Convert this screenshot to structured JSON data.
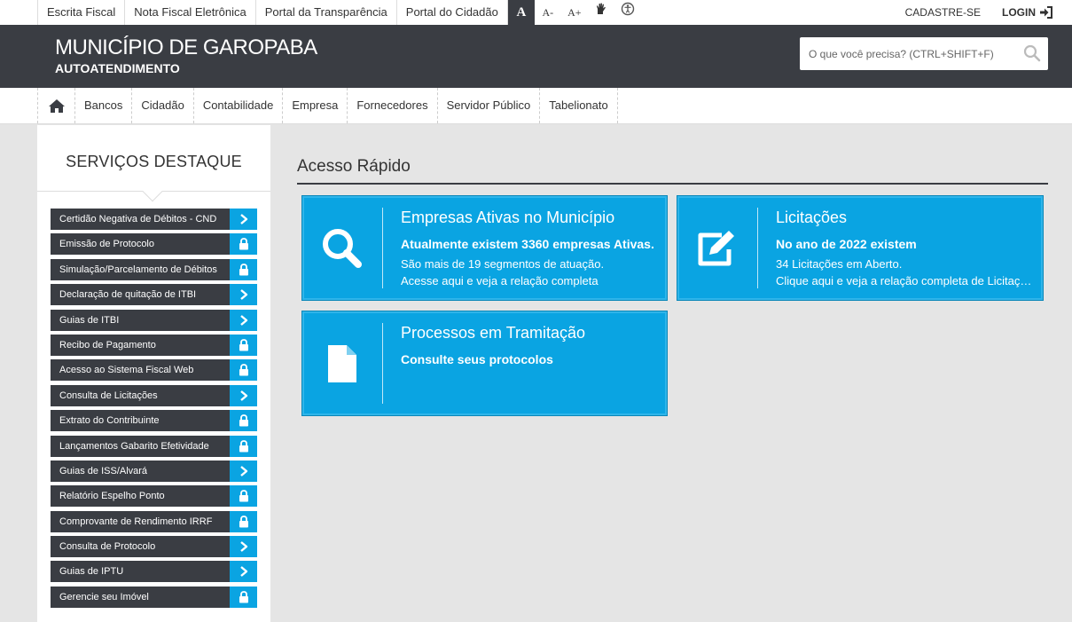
{
  "topbar": {
    "links": [
      "Escrita Fiscal",
      "Nota Fiscal Eletrônica",
      "Portal da Transparência",
      "Portal do Cidadão"
    ],
    "font_normal": "A",
    "font_decrease": "A-",
    "font_increase": "A+",
    "register": "CADASTRE-SE",
    "login": "LOGIN"
  },
  "header": {
    "title": "MUNICÍPIO DE GAROPABA",
    "subtitle": "AUTOATENDIMENTO",
    "search_placeholder": "O que você precisa? (CTRL+SHIFT+F)"
  },
  "nav": {
    "items": [
      "Bancos",
      "Cidadão",
      "Contabilidade",
      "Empresa",
      "Fornecedores",
      "Servidor Público",
      "Tabelionato"
    ]
  },
  "sidebar": {
    "title": "SERVIÇOS DESTAQUE",
    "services": [
      {
        "label": "Certidão Negativa de Débitos - CND",
        "icon": "chevron-right-icon"
      },
      {
        "label": "Emissão de Protocolo",
        "icon": "lock-icon"
      },
      {
        "label": "Simulação/Parcelamento de Débitos",
        "icon": "lock-icon"
      },
      {
        "label": "Declaração de quitação de ITBI",
        "icon": "chevron-right-icon"
      },
      {
        "label": "Guias de ITBI",
        "icon": "chevron-right-icon"
      },
      {
        "label": "Recibo de Pagamento",
        "icon": "lock-icon"
      },
      {
        "label": "Acesso ao Sistema Fiscal Web",
        "icon": "lock-icon"
      },
      {
        "label": "Consulta de Licitações",
        "icon": "chevron-right-icon"
      },
      {
        "label": "Extrato do Contribuinte",
        "icon": "lock-icon"
      },
      {
        "label": "Lançamentos Gabarito Efetividade",
        "icon": "lock-icon"
      },
      {
        "label": "Guias de ISS/Alvará",
        "icon": "chevron-right-icon"
      },
      {
        "label": "Relatório Espelho Ponto",
        "icon": "lock-icon"
      },
      {
        "label": "Comprovante de Rendimento IRRF",
        "icon": "lock-icon"
      },
      {
        "label": "Consulta de Protocolo",
        "icon": "chevron-right-icon"
      },
      {
        "label": "Guias de IPTU",
        "icon": "chevron-right-icon"
      },
      {
        "label": "Gerencie seu Imóvel",
        "icon": "lock-icon"
      }
    ]
  },
  "main": {
    "title": "Acesso Rápido",
    "cards": [
      {
        "title": "Empresas Ativas no Município",
        "line1": "Atualmente existem 3360 empresas Ativas.",
        "line2": "São mais de 19 segmentos de atuação.",
        "line3": "Acesse aqui e veja a relação completa",
        "icon": "search-icon"
      },
      {
        "title": "Licitações",
        "line1": "No ano de 2022 existem",
        "line2": "34 Licitações em Aberto.",
        "line3": "Clique aqui e veja a relação completa de Licitações",
        "icon": "edit-icon"
      },
      {
        "title": "Processos em Tramitação",
        "line1": "Consulte seus protocolos",
        "icon": "document-icon"
      }
    ]
  },
  "colors": {
    "dark": "#3a3d43",
    "accent": "#0aa4e2",
    "background": "#e5e5e5"
  }
}
